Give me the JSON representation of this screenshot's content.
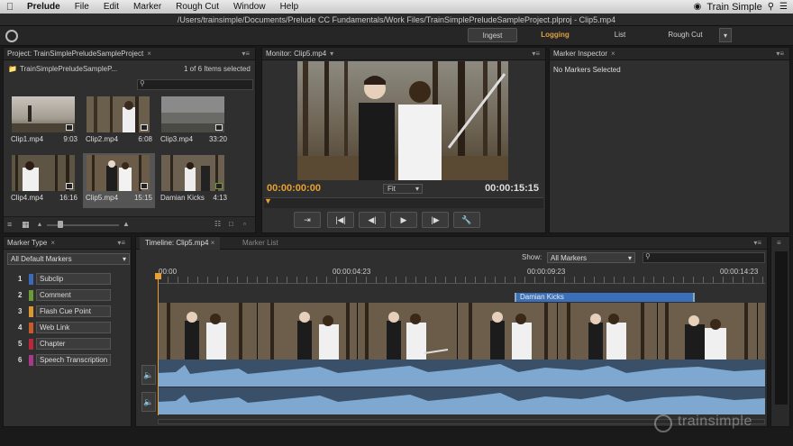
{
  "menubar": {
    "apple": "",
    "items": [
      "Prelude",
      "File",
      "Edit",
      "Marker",
      "Rough Cut",
      "Window",
      "Help"
    ],
    "brand": "Train Simple"
  },
  "window": {
    "title": "/Users/trainsimple/Documents/Prelude CC Fundamentals/Work Files/TrainSimplePreludeSampleProject.plproj - Clip5.mp4"
  },
  "workspace": {
    "tabs": [
      "Ingest",
      "Logging",
      "List",
      "Rough Cut"
    ],
    "active": "Logging",
    "accent": "#e0a040"
  },
  "project": {
    "tab": "Project: TrainSimplePreludeSampleProject",
    "name": "TrainSimplePreludeSampleP...",
    "count": "1 of 6 Items selected",
    "clips": [
      {
        "name": "Clip1.mp4",
        "duration": "9:03"
      },
      {
        "name": "Clip2.mp4",
        "duration": "6:08"
      },
      {
        "name": "Clip3.mp4",
        "duration": "33:20"
      },
      {
        "name": "Clip4.mp4",
        "duration": "16:16"
      },
      {
        "name": "Clip5.mp4",
        "duration": "15:15"
      },
      {
        "name": "Damian Kicks",
        "duration": "4:13"
      }
    ],
    "selected_index": 4
  },
  "monitor": {
    "tab": "Monitor: Clip5.mp4",
    "timecode_current": "00:00:00:00",
    "timecode_duration": "00:00:15:15",
    "zoom": "Fit"
  },
  "inspector": {
    "tab": "Marker Inspector",
    "empty": "No Markers Selected"
  },
  "marker_type": {
    "tab": "Marker Type",
    "filter": "All Default Markers",
    "items": [
      {
        "num": "1",
        "label": "Subclip",
        "color": "#3a6ab8"
      },
      {
        "num": "2",
        "label": "Comment",
        "color": "#6a9a3a"
      },
      {
        "num": "3",
        "label": "Flash Cue Point",
        "color": "#d89a30"
      },
      {
        "num": "4",
        "label": "Web Link",
        "color": "#c85a2a"
      },
      {
        "num": "5",
        "label": "Chapter",
        "color": "#b8283a"
      },
      {
        "num": "6",
        "label": "Speech Transcription",
        "color": "#a83a8a"
      }
    ]
  },
  "timeline": {
    "tab": "Timeline: Clip5.mp4",
    "tab2": "Marker List",
    "show_label": "Show:",
    "show_value": "All Markers",
    "ruler": [
      "00:00",
      "00:00:04:23",
      "00:00:09:23",
      "00:00:14:23"
    ],
    "marker_label": "Damian Kicks"
  },
  "watermark": "trainsimple"
}
